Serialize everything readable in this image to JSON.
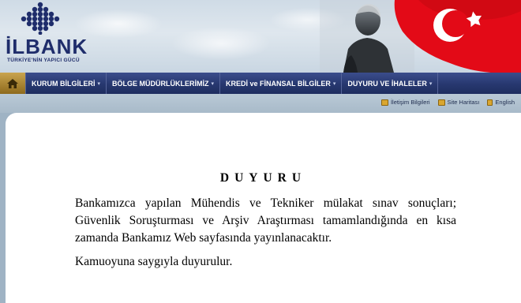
{
  "header": {
    "logo_text": "İLBANK",
    "logo_tagline": "TÜRKİYE'NİN YAPICI GÜCÜ"
  },
  "nav": {
    "home_icon": "home-icon",
    "items": [
      {
        "label": "KURUM BİLGİLERİ"
      },
      {
        "label": "BÖLGE MÜDÜRLÜKLERİMİZ"
      },
      {
        "label": "KREDİ ve FİNANSAL BİLGİLER"
      },
      {
        "label": "DUYURU VE İHALELER"
      }
    ]
  },
  "utility_links": {
    "contact": "İletişim Bilgileri",
    "sitemap": "Site Haritası",
    "english": "English"
  },
  "announcement": {
    "title": "DUYURU",
    "body": "Bankamızca yapılan Mühendis ve Tekniker mülakat sınav sonuçları; Güvenlik Soruşturması ve Arşiv Araştırması tamamlandığında en kısa zamanda Bankamız Web sayfasında yayınlanacaktır.",
    "closing": "Kamuoyuna saygıyla duyurulur."
  },
  "colors": {
    "nav_bg": "#27386f",
    "logo_blue": "#1f2d6b",
    "flag_red": "#e30a17"
  }
}
